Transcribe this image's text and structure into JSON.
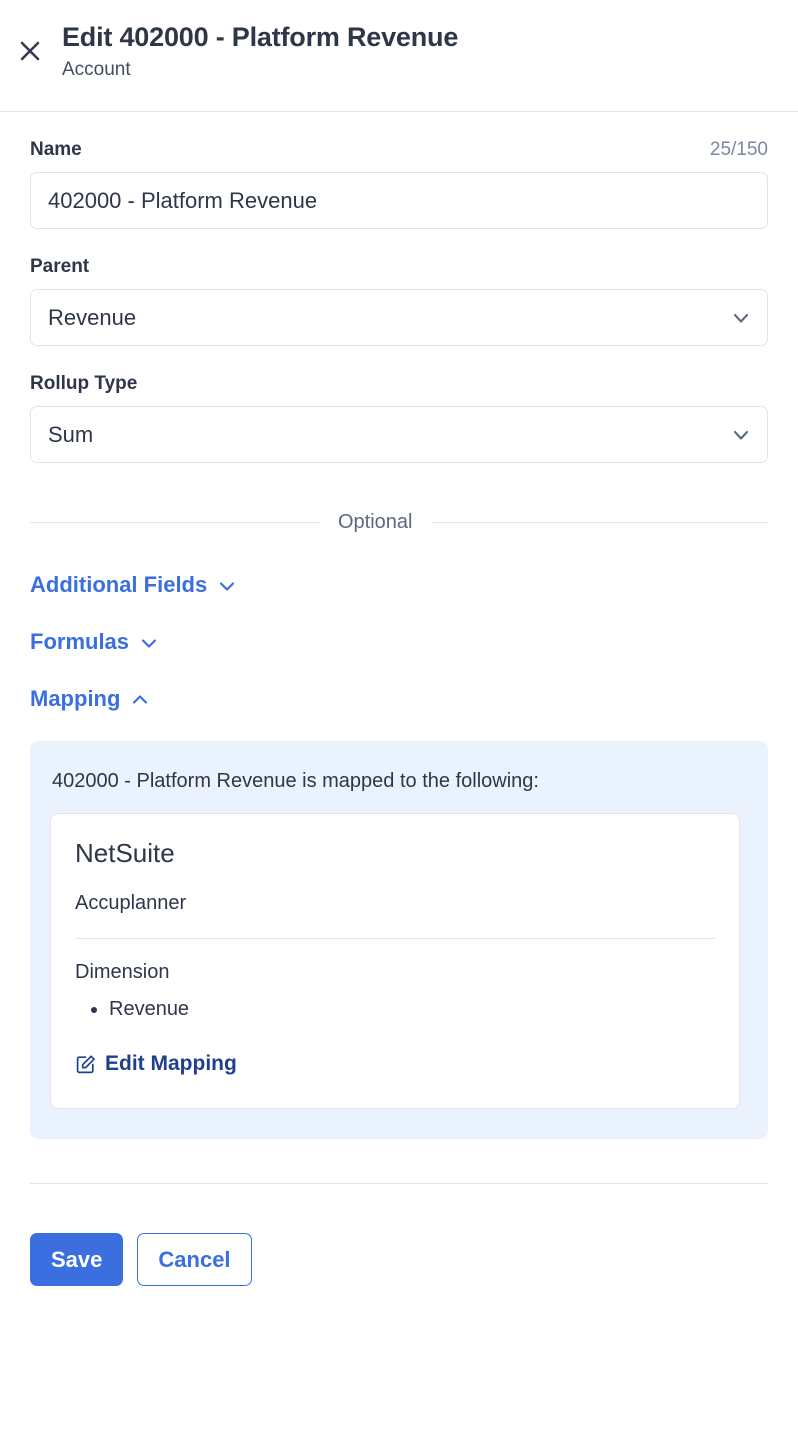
{
  "header": {
    "title": "Edit 402000 - Platform Revenue",
    "subtitle": "Account",
    "close_icon": "close-icon"
  },
  "form": {
    "name_field": {
      "label": "Name",
      "counter": "25/150",
      "value": "402000 - Platform Revenue",
      "placeholder": "Name"
    },
    "parent_field": {
      "label": "Parent",
      "value": "Revenue",
      "chevron_icon": "chevron-down-icon"
    },
    "rollup_field": {
      "label": "Rollup Type",
      "value": "Sum",
      "chevron_icon": "chevron-down-icon"
    }
  },
  "optional": {
    "divider_label": "Optional",
    "sections": [
      {
        "label": "Additional Fields",
        "state": "collapsed",
        "icon": "chevron-down-icon"
      },
      {
        "label": "Formulas",
        "state": "collapsed",
        "icon": "chevron-down-icon"
      },
      {
        "label": "Mapping",
        "state": "expanded",
        "icon": "chevron-up-icon"
      }
    ]
  },
  "mapping": {
    "intro": "402000 - Platform Revenue is mapped to the following:",
    "card": {
      "source": "NetSuite",
      "app": "Accuplanner",
      "dimension_label": "Dimension",
      "dimension_values": [
        "Revenue"
      ],
      "edit_link": "Edit Mapping",
      "edit_icon": "edit-pencil-icon"
    }
  },
  "footer": {
    "save_label": "Save",
    "cancel_label": "Cancel"
  },
  "colors": {
    "accent_blue": "#3b6fe0",
    "link_navy": "#1f3f8f",
    "text_dark": "#2e3648",
    "muted": "#7a879e",
    "panel_bg": "#eaf2fd",
    "border": "#e3e6ec"
  }
}
